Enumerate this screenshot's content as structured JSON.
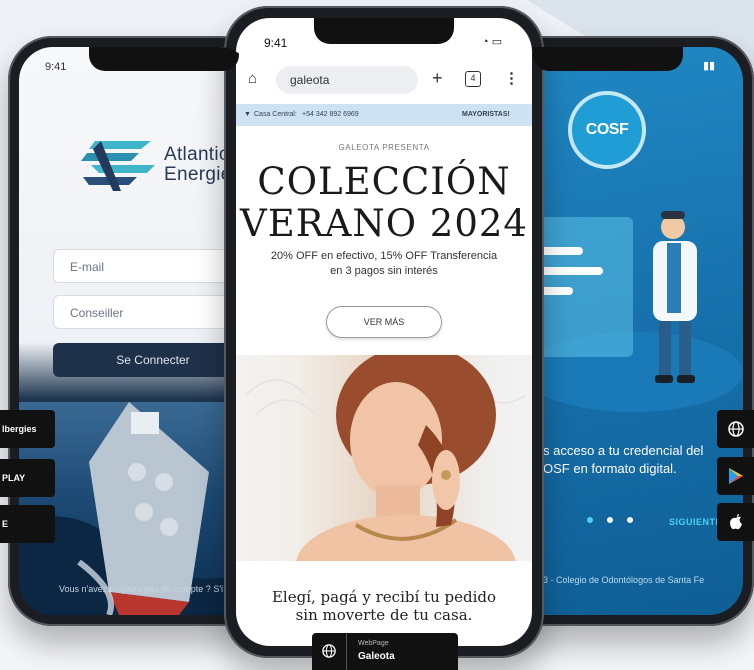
{
  "left_app": {
    "time": "9:41",
    "brand_line1": "Atlantic",
    "brand_line2": "Energie",
    "email_placeholder": "E-mail",
    "conseiller_placeholder": "Conseiller",
    "login_button": "Se Connecter",
    "signup_text": "Vous n'avez toujours pas de compte ? S'i"
  },
  "mid_app": {
    "time": "9:41",
    "url": "galeota",
    "tab_count": "4",
    "strip_left_prefix": "Casa Central:",
    "strip_phone": "+54 342 892 6969",
    "strip_right": "MAYORISTAS!",
    "eyebrow": "GALEOTA PRESENTA",
    "hero_line1": "COLECCIÓN",
    "hero_line2": "VERANO 2024",
    "promo_line1": "20% OFF en efectivo, 15% OFF Transferencia",
    "promo_line2": "en 3 pagos sin interés",
    "cta": "VER MÁS",
    "footer_line1": "Elegí, pagá y recibí tu pedido",
    "footer_line2": "sin moverte de tu casa."
  },
  "right_app": {
    "logo": "COSF",
    "text_line1": "s acceso a tu credencial del",
    "text_line2": "OSF en formato digital.",
    "next": "SIGUIENTE",
    "footer": "3 - Colegio de Odontólogos de Santa Fe"
  },
  "badges_left": [
    "lbergies",
    "PLAY",
    "E"
  ],
  "badges_right_icons": [
    "globe-icon",
    "google-play-icon",
    "apple-icon"
  ],
  "webpage_badge": {
    "small": "WebPage",
    "name": "Galeota"
  }
}
